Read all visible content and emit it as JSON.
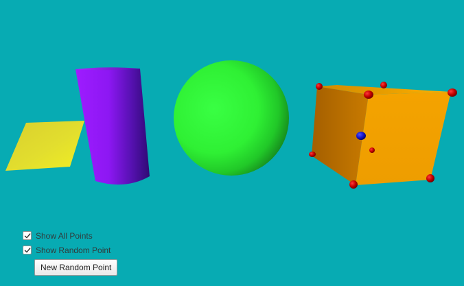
{
  "scene": {
    "background_color": "#07abb3",
    "objects": [
      {
        "name": "plane",
        "color": "#e6e127"
      },
      {
        "name": "cylinder",
        "color": "#9a20ff"
      },
      {
        "name": "sphere",
        "color": "#32ff3a"
      },
      {
        "name": "cube",
        "color": "#f0a000"
      }
    ],
    "point_colors": {
      "all_points": "#d80000",
      "random_point": "#1f16c7"
    }
  },
  "controls": {
    "show_all_points": {
      "label": "Show All Points",
      "checked": true
    },
    "show_random_point": {
      "label": "Show Random Point",
      "checked": true
    },
    "new_random_point_button": {
      "label": "New Random Point"
    }
  }
}
